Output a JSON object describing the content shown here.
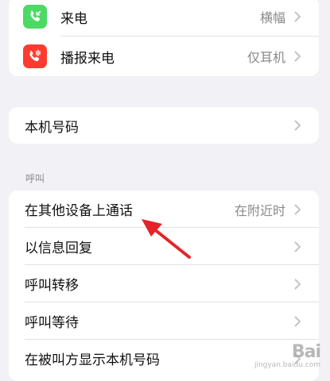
{
  "audio_group": {
    "rows": [
      {
        "label": "来电",
        "value": "横幅",
        "icon": "incoming-call-icon",
        "icon_color": "#4cd964"
      },
      {
        "label": "播报来电",
        "value": "仅耳机",
        "icon": "announce-call-icon",
        "icon_color": "#ff3b30"
      }
    ]
  },
  "number_group": {
    "label": "本机号码"
  },
  "calls_section": {
    "title": "呼叫",
    "rows": [
      {
        "label": "在其他设备上通话",
        "value": "在附近时"
      },
      {
        "label": "以信息回复",
        "value": ""
      },
      {
        "label": "呼叫转移",
        "value": ""
      },
      {
        "label": "呼叫等待",
        "value": ""
      },
      {
        "label": "在被叫方显示本机号码",
        "value": ""
      }
    ]
  },
  "colors": {
    "accent_arrow": "#e5232a",
    "chevron": "#c4c4c7"
  },
  "watermark": {
    "text": "Bai",
    "sub": "jingyan.baidu.com"
  }
}
